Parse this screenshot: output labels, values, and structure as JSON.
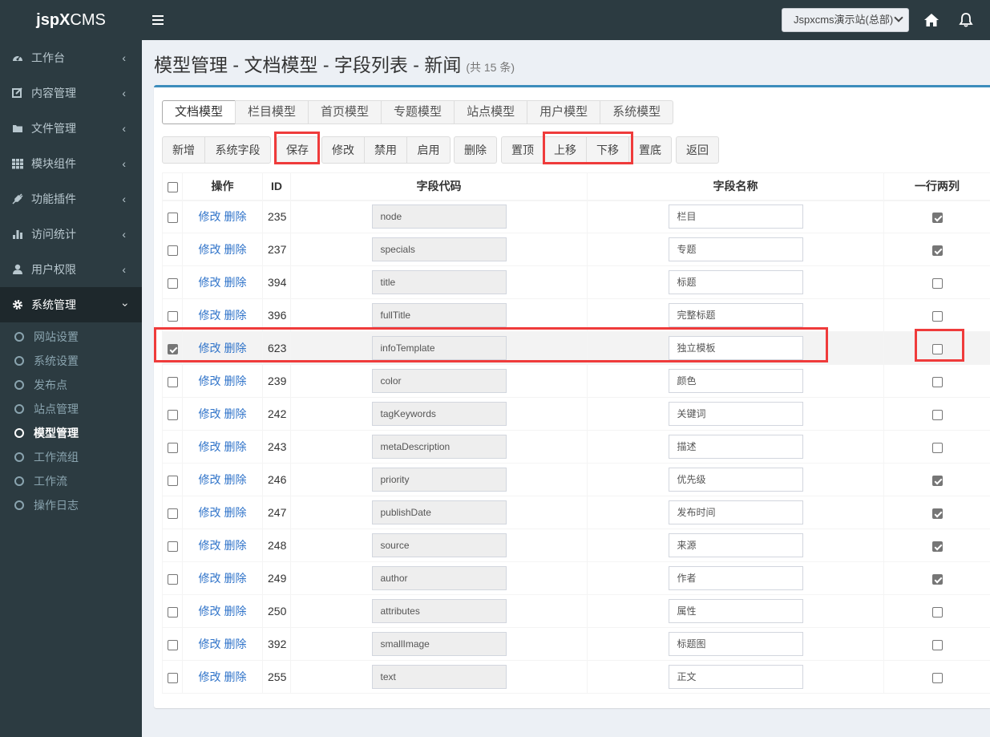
{
  "app": {
    "logo_bold": "jspX",
    "logo_rest": "CMS",
    "site_select": "Jspxcms演示站(总部)"
  },
  "sidebar": {
    "items": [
      {
        "label": "工作台",
        "icon": "dashboard-icon"
      },
      {
        "label": "内容管理",
        "icon": "edit-icon"
      },
      {
        "label": "文件管理",
        "icon": "folder-icon"
      },
      {
        "label": "模块组件",
        "icon": "grid-icon"
      },
      {
        "label": "功能插件",
        "icon": "plug-icon"
      },
      {
        "label": "访问统计",
        "icon": "bar-chart-icon"
      },
      {
        "label": "用户权限",
        "icon": "user-icon"
      },
      {
        "label": "系统管理",
        "icon": "gear-icon",
        "active": true
      }
    ],
    "sub_items": [
      {
        "label": "网站设置"
      },
      {
        "label": "系统设置"
      },
      {
        "label": "发布点"
      },
      {
        "label": "站点管理"
      },
      {
        "label": "模型管理",
        "active": true
      },
      {
        "label": "工作流组"
      },
      {
        "label": "工作流"
      },
      {
        "label": "操作日志"
      }
    ]
  },
  "page": {
    "title": "模型管理 - 文档模型 - 字段列表 - 新闻",
    "count": "(共 15 条)"
  },
  "tabs": [
    {
      "label": "文档模型",
      "active": true
    },
    {
      "label": "栏目模型"
    },
    {
      "label": "首页模型"
    },
    {
      "label": "专题模型"
    },
    {
      "label": "站点模型"
    },
    {
      "label": "用户模型"
    },
    {
      "label": "系统模型"
    }
  ],
  "toolbar": {
    "add": "新增",
    "system_fields": "系统字段",
    "save": "保存",
    "edit": "修改",
    "disable": "禁用",
    "enable": "启用",
    "delete": "删除",
    "top": "置顶",
    "up": "上移",
    "down": "下移",
    "bottom": "置底",
    "back": "返回"
  },
  "table": {
    "headers": {
      "ops": "操作",
      "id": "ID",
      "code": "字段代码",
      "name": "字段名称",
      "two_col": "一行两列"
    },
    "edit_label": "修改",
    "delete_label": "删除",
    "rows": [
      {
        "id": "235",
        "code": "node",
        "name": "栏目",
        "two_col": true,
        "selected": false
      },
      {
        "id": "237",
        "code": "specials",
        "name": "专题",
        "two_col": true,
        "selected": false
      },
      {
        "id": "394",
        "code": "title",
        "name": "标题",
        "two_col": false,
        "selected": false
      },
      {
        "id": "396",
        "code": "fullTitle",
        "name": "完整标题",
        "two_col": false,
        "selected": false
      },
      {
        "id": "623",
        "code": "infoTemplate",
        "name": "独立模板",
        "two_col": false,
        "selected": true
      },
      {
        "id": "239",
        "code": "color",
        "name": "颜色",
        "two_col": false,
        "selected": false
      },
      {
        "id": "242",
        "code": "tagKeywords",
        "name": "关键词",
        "two_col": false,
        "selected": false
      },
      {
        "id": "243",
        "code": "metaDescription",
        "name": "描述",
        "two_col": false,
        "selected": false
      },
      {
        "id": "246",
        "code": "priority",
        "name": "优先级",
        "two_col": true,
        "selected": false
      },
      {
        "id": "247",
        "code": "publishDate",
        "name": "发布时间",
        "two_col": true,
        "selected": false
      },
      {
        "id": "248",
        "code": "source",
        "name": "来源",
        "two_col": true,
        "selected": false
      },
      {
        "id": "249",
        "code": "author",
        "name": "作者",
        "two_col": true,
        "selected": false
      },
      {
        "id": "250",
        "code": "attributes",
        "name": "属性",
        "two_col": false,
        "selected": false
      },
      {
        "id": "392",
        "code": "smallImage",
        "name": "标题图",
        "two_col": false,
        "selected": false
      },
      {
        "id": "255",
        "code": "text",
        "name": "正文",
        "two_col": false,
        "selected": false
      }
    ]
  },
  "colors": {
    "sidebar_bg": "#2c3b41",
    "accent": "#3c8dbc",
    "highlight": "#ef3b3b",
    "link": "#2f73c9"
  }
}
